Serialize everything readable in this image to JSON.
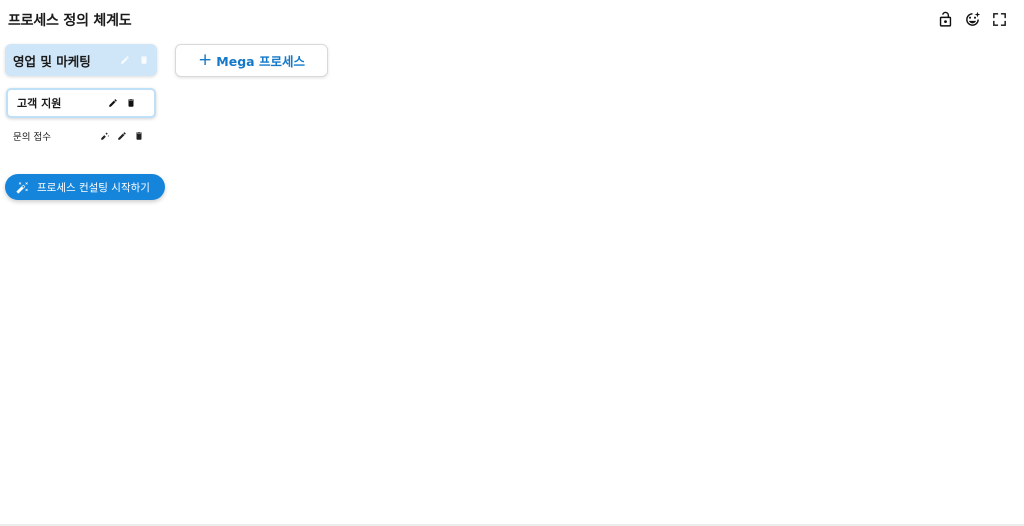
{
  "header": {
    "title": "프로세스 정의 체계도",
    "actions": [
      {
        "icon": "lock-open-icon"
      },
      {
        "icon": "emoji-edit-icon"
      },
      {
        "icon": "fullscreen-icon"
      }
    ]
  },
  "tree": {
    "mega": {
      "label": "영업 및 마케팅",
      "icons": [
        "edit-icon",
        "delete-icon"
      ]
    },
    "major": {
      "label": "고객 지원",
      "icons": [
        "edit-icon",
        "delete-icon"
      ]
    },
    "process": {
      "label": "문의 접수",
      "icons": [
        "ai-edit-icon",
        "edit-icon",
        "delete-icon"
      ]
    }
  },
  "consult_button": {
    "label": "프로세스 컨설팅 시작하기",
    "icon": "magic-wand-icon",
    "color": "#1585dc"
  },
  "add_mega_button": {
    "plus": "+",
    "label": "Mega 프로세스",
    "color": "#1479c8"
  },
  "colors": {
    "mega_card_bg": "#cfe6f8",
    "major_card_border": "#bfe0f7"
  }
}
